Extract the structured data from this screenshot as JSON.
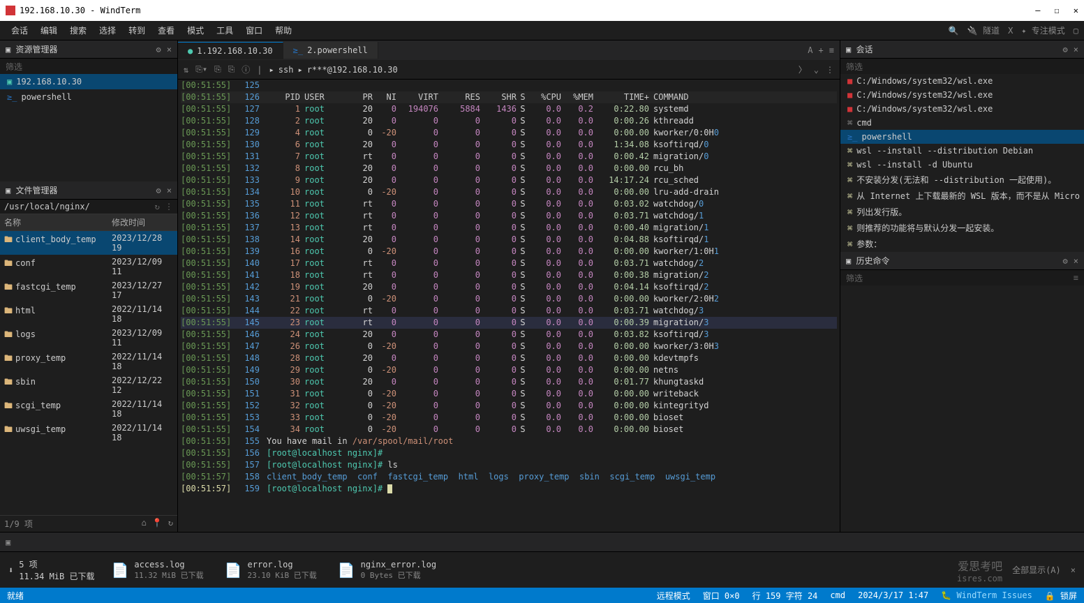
{
  "window": {
    "title": "192.168.10.30 - WindTerm",
    "min": "—",
    "max": "☐",
    "close": "✕"
  },
  "menu": [
    "会话",
    "编辑",
    "搜索",
    "选择",
    "转到",
    "查看",
    "模式",
    "工具",
    "窗口",
    "帮助"
  ],
  "menuRight": {
    "tunnel": "隧道",
    "x": "X",
    "focus": "专注模式"
  },
  "resMgr": {
    "title": "资源管理器",
    "filter": "筛选",
    "items": [
      {
        "icon": "term",
        "label": "192.168.10.30",
        "active": true
      },
      {
        "icon": "ps",
        "label": "powershell",
        "active": false
      }
    ]
  },
  "fileMgr": {
    "title": "文件管理器",
    "path": "/usr/local/nginx/",
    "col1": "名称",
    "col2": "修改时间",
    "files": [
      {
        "n": "client_body_temp",
        "d": "2023/12/28 19",
        "sel": true
      },
      {
        "n": "conf",
        "d": "2023/12/09 11"
      },
      {
        "n": "fastcgi_temp",
        "d": "2023/12/27 17"
      },
      {
        "n": "html",
        "d": "2022/11/14 18"
      },
      {
        "n": "logs",
        "d": "2023/12/09 11"
      },
      {
        "n": "proxy_temp",
        "d": "2022/11/14 18"
      },
      {
        "n": "sbin",
        "d": "2022/12/22 12"
      },
      {
        "n": "scgi_temp",
        "d": "2022/11/14 18"
      },
      {
        "n": "uwsgi_temp",
        "d": "2022/11/14 18"
      }
    ],
    "status": "1/9 项"
  },
  "tabs": [
    {
      "label": "1.192.168.10.30",
      "icon": "term",
      "active": true
    },
    {
      "label": "2.powershell",
      "icon": "ps",
      "active": false
    }
  ],
  "toolbar": {
    "proto": "ssh",
    "host": "r***@192.168.10.30"
  },
  "processHeader": [
    "PID",
    "USER",
    "PR",
    "NI",
    "VIRT",
    "RES",
    "SHR",
    "S",
    "%CPU",
    "%MEM",
    "TIME+",
    "COMMAND"
  ],
  "processes": [
    {
      "ts": "[00:51:55]",
      "ln": "125"
    },
    {
      "ts": "[00:51:55]",
      "ln": "126",
      "hdr": true
    },
    {
      "ts": "[00:51:55]",
      "ln": "127",
      "pid": "1",
      "user": "root",
      "pr": "20",
      "ni": "0",
      "virt": "194076",
      "res": "5884",
      "shr": "1436",
      "s": "S",
      "cpu": "0.0",
      "mem": "0.2",
      "time": "0:22.80",
      "cmd": "systemd"
    },
    {
      "ts": "[00:51:55]",
      "ln": "128",
      "pid": "2",
      "user": "root",
      "pr": "20",
      "ni": "0",
      "virt": "0",
      "res": "0",
      "shr": "0",
      "s": "S",
      "cpu": "0.0",
      "mem": "0.0",
      "time": "0:00.26",
      "cmd": "kthreadd"
    },
    {
      "ts": "[00:51:55]",
      "ln": "129",
      "pid": "4",
      "user": "root",
      "pr": "0",
      "ni": "-20",
      "virt": "0",
      "res": "0",
      "shr": "0",
      "s": "S",
      "cpu": "0.0",
      "mem": "0.0",
      "time": "0:00.00",
      "cmd": "kworker/0:0H",
      "suf": "0"
    },
    {
      "ts": "[00:51:55]",
      "ln": "130",
      "pid": "6",
      "user": "root",
      "pr": "20",
      "ni": "0",
      "virt": "0",
      "res": "0",
      "shr": "0",
      "s": "S",
      "cpu": "0.0",
      "mem": "0.0",
      "time": "1:34.08",
      "cmd": "ksoftirqd/",
      "suf": "0"
    },
    {
      "ts": "[00:51:55]",
      "ln": "131",
      "pid": "7",
      "user": "root",
      "pr": "rt",
      "ni": "0",
      "virt": "0",
      "res": "0",
      "shr": "0",
      "s": "S",
      "cpu": "0.0",
      "mem": "0.0",
      "time": "0:00.42",
      "cmd": "migration/",
      "suf": "0"
    },
    {
      "ts": "[00:51:55]",
      "ln": "132",
      "pid": "8",
      "user": "root",
      "pr": "20",
      "ni": "0",
      "virt": "0",
      "res": "0",
      "shr": "0",
      "s": "S",
      "cpu": "0.0",
      "mem": "0.0",
      "time": "0:00.00",
      "cmd": "rcu_bh"
    },
    {
      "ts": "[00:51:55]",
      "ln": "133",
      "pid": "9",
      "user": "root",
      "pr": "20",
      "ni": "0",
      "virt": "0",
      "res": "0",
      "shr": "0",
      "s": "S",
      "cpu": "0.0",
      "mem": "0.0",
      "time": "14:17.24",
      "cmd": "rcu_sched"
    },
    {
      "ts": "[00:51:55]",
      "ln": "134",
      "pid": "10",
      "user": "root",
      "pr": "0",
      "ni": "-20",
      "virt": "0",
      "res": "0",
      "shr": "0",
      "s": "S",
      "cpu": "0.0",
      "mem": "0.0",
      "time": "0:00.00",
      "cmd": "lru-add-drain"
    },
    {
      "ts": "[00:51:55]",
      "ln": "135",
      "pid": "11",
      "user": "root",
      "pr": "rt",
      "ni": "0",
      "virt": "0",
      "res": "0",
      "shr": "0",
      "s": "S",
      "cpu": "0.0",
      "mem": "0.0",
      "time": "0:03.02",
      "cmd": "watchdog/",
      "suf": "0"
    },
    {
      "ts": "[00:51:55]",
      "ln": "136",
      "pid": "12",
      "user": "root",
      "pr": "rt",
      "ni": "0",
      "virt": "0",
      "res": "0",
      "shr": "0",
      "s": "S",
      "cpu": "0.0",
      "mem": "0.0",
      "time": "0:03.71",
      "cmd": "watchdog/",
      "suf": "1"
    },
    {
      "ts": "[00:51:55]",
      "ln": "137",
      "pid": "13",
      "user": "root",
      "pr": "rt",
      "ni": "0",
      "virt": "0",
      "res": "0",
      "shr": "0",
      "s": "S",
      "cpu": "0.0",
      "mem": "0.0",
      "time": "0:00.40",
      "cmd": "migration/",
      "suf": "1"
    },
    {
      "ts": "[00:51:55]",
      "ln": "138",
      "pid": "14",
      "user": "root",
      "pr": "20",
      "ni": "0",
      "virt": "0",
      "res": "0",
      "shr": "0",
      "s": "S",
      "cpu": "0.0",
      "mem": "0.0",
      "time": "0:04.88",
      "cmd": "ksoftirqd/",
      "suf": "1"
    },
    {
      "ts": "[00:51:55]",
      "ln": "139",
      "pid": "16",
      "user": "root",
      "pr": "0",
      "ni": "-20",
      "virt": "0",
      "res": "0",
      "shr": "0",
      "s": "S",
      "cpu": "0.0",
      "mem": "0.0",
      "time": "0:00.00",
      "cmd": "kworker/1:0H",
      "suf": "1"
    },
    {
      "ts": "[00:51:55]",
      "ln": "140",
      "pid": "17",
      "user": "root",
      "pr": "rt",
      "ni": "0",
      "virt": "0",
      "res": "0",
      "shr": "0",
      "s": "S",
      "cpu": "0.0",
      "mem": "0.0",
      "time": "0:03.71",
      "cmd": "watchdog/",
      "suf": "2"
    },
    {
      "ts": "[00:51:55]",
      "ln": "141",
      "pid": "18",
      "user": "root",
      "pr": "rt",
      "ni": "0",
      "virt": "0",
      "res": "0",
      "shr": "0",
      "s": "S",
      "cpu": "0.0",
      "mem": "0.0",
      "time": "0:00.38",
      "cmd": "migration/",
      "suf": "2"
    },
    {
      "ts": "[00:51:55]",
      "ln": "142",
      "pid": "19",
      "user": "root",
      "pr": "20",
      "ni": "0",
      "virt": "0",
      "res": "0",
      "shr": "0",
      "s": "S",
      "cpu": "0.0",
      "mem": "0.0",
      "time": "0:04.14",
      "cmd": "ksoftirqd/",
      "suf": "2"
    },
    {
      "ts": "[00:51:55]",
      "ln": "143",
      "pid": "21",
      "user": "root",
      "pr": "0",
      "ni": "-20",
      "virt": "0",
      "res": "0",
      "shr": "0",
      "s": "S",
      "cpu": "0.0",
      "mem": "0.0",
      "time": "0:00.00",
      "cmd": "kworker/2:0H",
      "suf": "2"
    },
    {
      "ts": "[00:51:55]",
      "ln": "144",
      "pid": "22",
      "user": "root",
      "pr": "rt",
      "ni": "0",
      "virt": "0",
      "res": "0",
      "shr": "0",
      "s": "S",
      "cpu": "0.0",
      "mem": "0.0",
      "time": "0:03.71",
      "cmd": "watchdog/",
      "suf": "3"
    },
    {
      "ts": "[00:51:55]",
      "ln": "145",
      "pid": "23",
      "user": "root",
      "pr": "rt",
      "ni": "0",
      "virt": "0",
      "res": "0",
      "shr": "0",
      "s": "S",
      "cpu": "0.0",
      "mem": "0.0",
      "time": "0:00.39",
      "cmd": "migration/",
      "suf": "3",
      "hl": true
    },
    {
      "ts": "[00:51:55]",
      "ln": "146",
      "pid": "24",
      "user": "root",
      "pr": "20",
      "ni": "0",
      "virt": "0",
      "res": "0",
      "shr": "0",
      "s": "S",
      "cpu": "0.0",
      "mem": "0.0",
      "time": "0:03.82",
      "cmd": "ksoftirqd/",
      "suf": "3"
    },
    {
      "ts": "[00:51:55]",
      "ln": "147",
      "pid": "26",
      "user": "root",
      "pr": "0",
      "ni": "-20",
      "virt": "0",
      "res": "0",
      "shr": "0",
      "s": "S",
      "cpu": "0.0",
      "mem": "0.0",
      "time": "0:00.00",
      "cmd": "kworker/3:0H",
      "suf": "3"
    },
    {
      "ts": "[00:51:55]",
      "ln": "148",
      "pid": "28",
      "user": "root",
      "pr": "20",
      "ni": "0",
      "virt": "0",
      "res": "0",
      "shr": "0",
      "s": "S",
      "cpu": "0.0",
      "mem": "0.0",
      "time": "0:00.00",
      "cmd": "kdevtmpfs"
    },
    {
      "ts": "[00:51:55]",
      "ln": "149",
      "pid": "29",
      "user": "root",
      "pr": "0",
      "ni": "-20",
      "virt": "0",
      "res": "0",
      "shr": "0",
      "s": "S",
      "cpu": "0.0",
      "mem": "0.0",
      "time": "0:00.00",
      "cmd": "netns"
    },
    {
      "ts": "[00:51:55]",
      "ln": "150",
      "pid": "30",
      "user": "root",
      "pr": "20",
      "ni": "0",
      "virt": "0",
      "res": "0",
      "shr": "0",
      "s": "S",
      "cpu": "0.0",
      "mem": "0.0",
      "time": "0:01.77",
      "cmd": "khungtaskd"
    },
    {
      "ts": "[00:51:55]",
      "ln": "151",
      "pid": "31",
      "user": "root",
      "pr": "0",
      "ni": "-20",
      "virt": "0",
      "res": "0",
      "shr": "0",
      "s": "S",
      "cpu": "0.0",
      "mem": "0.0",
      "time": "0:00.00",
      "cmd": "writeback"
    },
    {
      "ts": "[00:51:55]",
      "ln": "152",
      "pid": "32",
      "user": "root",
      "pr": "0",
      "ni": "-20",
      "virt": "0",
      "res": "0",
      "shr": "0",
      "s": "S",
      "cpu": "0.0",
      "mem": "0.0",
      "time": "0:00.00",
      "cmd": "kintegrityd"
    },
    {
      "ts": "[00:51:55]",
      "ln": "153",
      "pid": "33",
      "user": "root",
      "pr": "0",
      "ni": "-20",
      "virt": "0",
      "res": "0",
      "shr": "0",
      "s": "S",
      "cpu": "0.0",
      "mem": "0.0",
      "time": "0:00.00",
      "cmd": "bioset"
    },
    {
      "ts": "[00:51:55]",
      "ln": "154",
      "pid": "34",
      "user": "root",
      "pr": "0",
      "ni": "-20",
      "virt": "0",
      "res": "0",
      "shr": "0",
      "s": "S",
      "cpu": "0.0",
      "mem": "0.0",
      "time": "0:00.00",
      "cmd": "bioset"
    }
  ],
  "termTail": [
    {
      "ts": "[00:51:55]",
      "ln": "155",
      "text": "You have mail in ",
      "path": "/var/spool/mail/root"
    },
    {
      "ts": "[00:51:55]",
      "ln": "156",
      "prompt": "[root@localhost nginx]#",
      "cmd": ""
    },
    {
      "ts": "[00:51:55]",
      "ln": "157",
      "prompt": "[root@localhost nginx]#",
      "cmd": " ls"
    },
    {
      "ts": "[00:51:57]",
      "ln": "158",
      "ls": [
        "client_body_temp",
        "conf",
        "fastcgi_temp",
        "html",
        "logs",
        "proxy_temp",
        "sbin",
        "scgi_temp",
        "uwsgi_temp"
      ]
    },
    {
      "ts": "[00:51:57]",
      "ln": "159",
      "prompt": "[root@localhost nginx]#",
      "cursor": true,
      "tsClass": "c-y"
    }
  ],
  "session": {
    "title": "会话",
    "filter": "筛选",
    "items": [
      {
        "ico": "r",
        "t": "C:/Windows/system32/wsl.exe"
      },
      {
        "ico": "r",
        "t": "C:/Windows/system32/wsl.exe"
      },
      {
        "ico": "r",
        "t": "C:/Windows/system32/wsl.exe"
      },
      {
        "ico": "c",
        "t": "cmd"
      },
      {
        "ico": "ps",
        "t": "powershell",
        "sel": true
      },
      {
        "ico": "b",
        "t": "wsl --install --distribution Debian"
      },
      {
        "ico": "b",
        "t": "wsl --install -d Ubuntu"
      },
      {
        "ico": "b",
        "t": "不安装分发(无法和 --distribution 一起使用)。"
      },
      {
        "ico": "b",
        "t": "从 Internet 上下载最新的 WSL 版本，而不是从 Micro"
      },
      {
        "ico": "b",
        "t": "列出发行版。"
      },
      {
        "ico": "b",
        "t": "则推荐的功能将与默认分发一起安装。"
      },
      {
        "ico": "b",
        "t": "参数："
      }
    ]
  },
  "history": {
    "title": "历史命令",
    "filter": "筛选"
  },
  "downloads": {
    "total": "5 项",
    "totalSize": "11.34 MiB 已下载",
    "items": [
      {
        "name": "access.log",
        "meta": "11.32 MiB 已下载"
      },
      {
        "name": "error.log",
        "meta": "23.10 KiB 已下载"
      },
      {
        "name": "nginx_error.log",
        "meta": "0 Bytes 已下载"
      }
    ],
    "showAll": "全部显示(A)"
  },
  "status": {
    "ready": "就绪",
    "mode": "远程模式",
    "win": "窗口 0×0",
    "pos": "行 159 字符 24",
    "enc": "cmd",
    "date": "2024/3/17 1:47",
    "issues": "WindTerm Issues",
    "lock": "锁屏"
  },
  "watermark": {
    "l1": "爱思考吧",
    "l2": "isres.com"
  }
}
